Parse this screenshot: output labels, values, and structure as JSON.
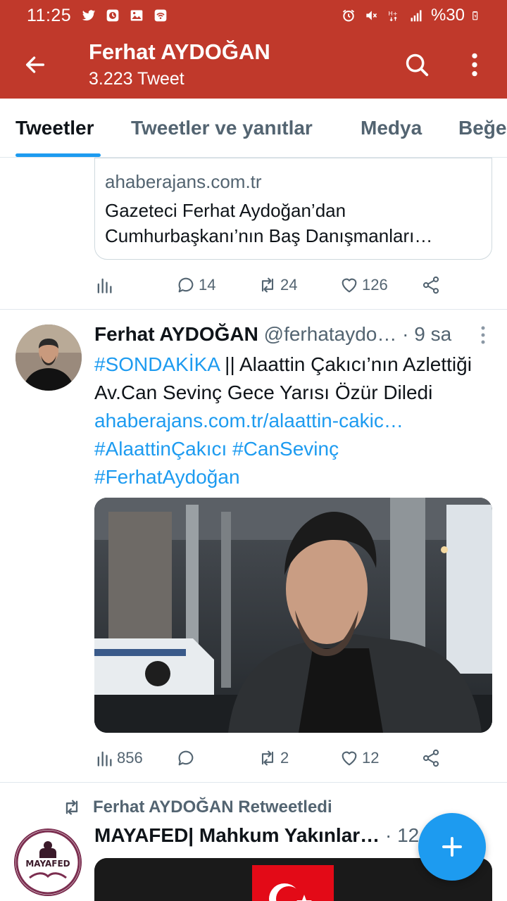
{
  "status_bar": {
    "time": "11:25",
    "battery": "%30",
    "left_icons": [
      "twitter-icon",
      "clock-app-icon",
      "gallery-icon",
      "wifi-call-icon"
    ],
    "right_icons": [
      "alarm-icon",
      "mute-icon",
      "data-h-plus-icon",
      "signal-icon",
      "battery-icon"
    ]
  },
  "app_bar": {
    "title": "Ferhat AYDOĞAN",
    "subtitle": "3.223 Tweet",
    "color": "#c0392b"
  },
  "tabs": {
    "items": [
      {
        "label": "Tweetler",
        "active": true
      },
      {
        "label": "Tweetler ve yanıtlar",
        "active": false
      },
      {
        "label": "Medya",
        "active": false
      },
      {
        "label": "Beğe",
        "active": false
      }
    ]
  },
  "card_tweet": {
    "link_card": {
      "domain": "ahaberajans.com.tr",
      "title": "Gazeteci Ferhat Aydoğan’dan Cumhurbaşkanı’nın Baş Danışmanları…"
    },
    "actions": {
      "views": "",
      "replies": "14",
      "retweets": "24",
      "likes": "126"
    }
  },
  "tweet": {
    "author_name": "Ferhat AYDOĞAN",
    "handle": "@ferhataydo…",
    "separator": "·",
    "time": "9 sa",
    "text_segments": {
      "hashtag1": "#SONDAKİKA",
      "plain1": " || Alaattin Çakıcı’nın Azlettiği Av.Can Sevinç Gece Yarısı Özür Diledi ",
      "link": "ahaberajans.com.tr/alaattin-cakic…",
      "hashtag2": "#AlaattinÇakıcı",
      "hashtag3": "#CanSevinç",
      "hashtag4": "#FerhatAydoğan"
    },
    "actions": {
      "views": "856",
      "replies": "",
      "retweets": "2",
      "likes": "12"
    }
  },
  "retweet": {
    "label": "Ferhat AYDOĞAN Retweetledi",
    "author_name": "MAYAFED| Mahkum Yakınlar…",
    "separator": "·",
    "time_partial": "12",
    "avatar_text": "MAYAFED"
  },
  "colors": {
    "accent": "#1d9bf0",
    "header": "#c0392b",
    "secondary_text": "#536471"
  }
}
